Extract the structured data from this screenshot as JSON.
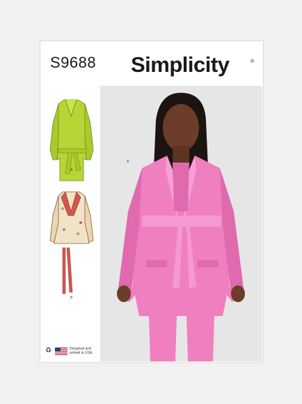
{
  "envelope": {
    "style_number": "S9688",
    "brand": "Simplicity",
    "brand_mark": "®",
    "photo_view_label": "A",
    "sketch_a_label": "A",
    "sketch_b_label": "B",
    "footer": {
      "designed_line1": "Designed and",
      "designed_line2": "printed in USA.",
      "recycle_icon": "recycle-icon",
      "flag_icon": "us-flag-icon"
    },
    "colors": {
      "jacket_pink": "#f07fc0",
      "jacket_lime": "#b6d636",
      "floral_lapel": "#d9534f",
      "background": "#e6e6e6"
    }
  }
}
